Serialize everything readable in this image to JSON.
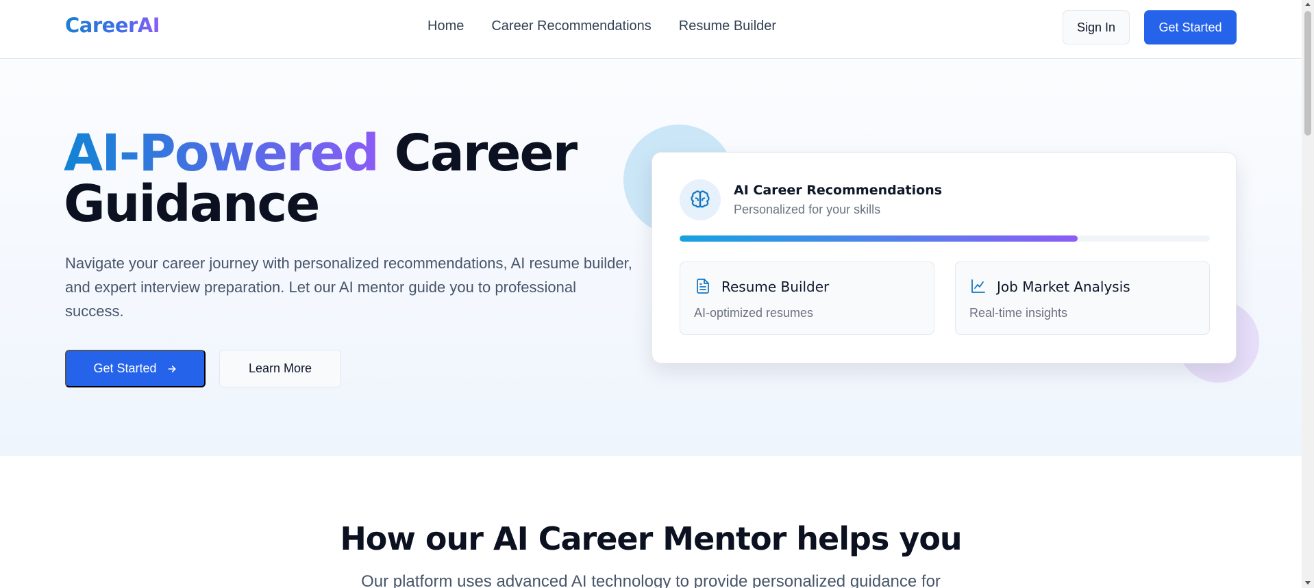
{
  "header": {
    "logo": "CareerAI",
    "nav": [
      "Home",
      "Career Recommendations",
      "Resume Builder"
    ],
    "sign_in": "Sign In",
    "get_started": "Get Started"
  },
  "hero": {
    "title_highlight": "AI-Powered",
    "title_rest_1": "Career",
    "title_rest_2": "Guidance",
    "description": "Navigate your career journey with personalized recommendations, AI resume builder, and expert interview preparation. Let our AI mentor guide you to professional success.",
    "primary_button": "Get Started",
    "secondary_button": "Learn More"
  },
  "card": {
    "icon": "brain-icon",
    "title": "AI Career Recommendations",
    "subtitle": "Personalized for your skills",
    "progress": 0.75,
    "features": [
      {
        "icon": "document-icon",
        "title": "Resume Builder",
        "desc": "AI-optimized resumes"
      },
      {
        "icon": "chart-line-icon",
        "title": "Job Market Analysis",
        "desc": "Real-time insights"
      }
    ]
  },
  "section": {
    "title": "How our AI Career Mentor helps you",
    "description": "Our platform uses advanced AI technology to provide personalized guidance for"
  },
  "colors": {
    "primary": "#2563eb",
    "gradient_start": "#1284d4",
    "gradient_end": "#8b5cf6",
    "icon_accent": "#1476c2"
  }
}
